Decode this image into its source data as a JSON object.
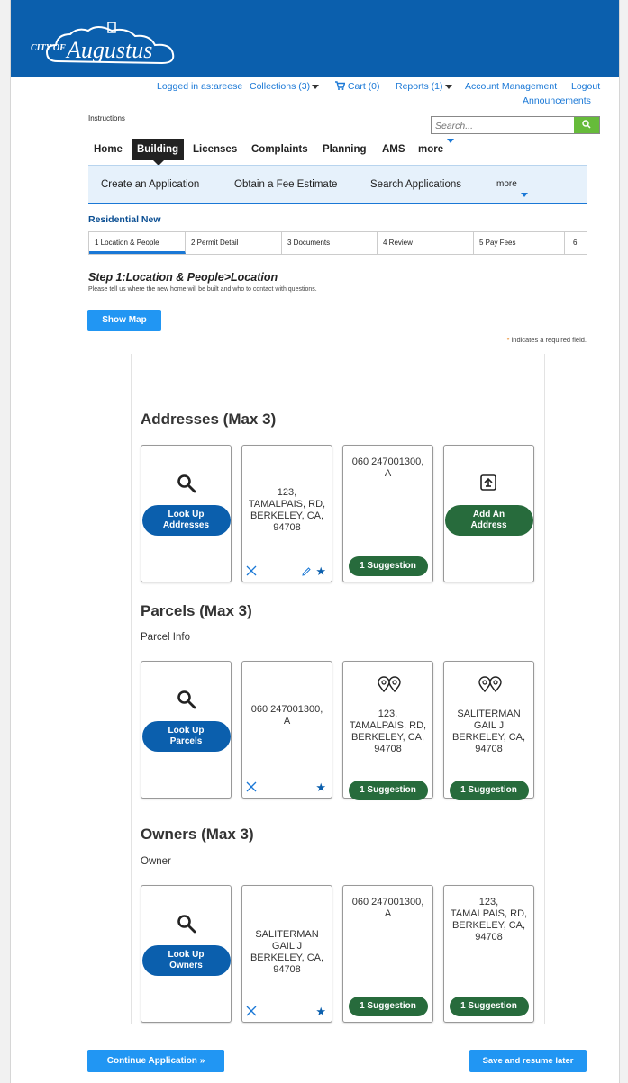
{
  "header": {
    "logo_prefix": "CITY OF",
    "logo_name": "Augustus"
  },
  "toplinks": {
    "logged_in": "Logged in as:areese",
    "collections": "Collections (3)",
    "cart": "Cart (0)",
    "reports": "Reports (1)",
    "account": "Account Management",
    "logout": "Logout",
    "announcements": "Announcements"
  },
  "instructions": "Instructions",
  "search": {
    "placeholder": "Search..."
  },
  "mainnav": [
    "Home",
    "Building",
    "Licenses",
    "Complaints",
    "Planning",
    "AMS",
    "more"
  ],
  "subnav": [
    "Create an Application",
    "Obtain a Fee Estimate",
    "Search Applications",
    "more"
  ],
  "section_label": "Residential New",
  "steps": [
    "1 Location & People",
    "2 Permit Detail",
    "3 Documents",
    "4 Review",
    "5 Pay Fees",
    "6"
  ],
  "step_title": "Step 1:Location & People>Location",
  "step_subtitle": "Please tell us where the new home will be built and who to contact with questions.",
  "show_map": "Show Map",
  "required_note": "indicates a required field.",
  "required_star": "*",
  "addresses": {
    "title": "Addresses (Max 3)",
    "lookup": [
      "Look Up",
      "Addresses"
    ],
    "card2": [
      "123,",
      "TAMALPAIS, RD,",
      "BERKELEY, CA,",
      "94708"
    ],
    "card3": [
      "060 247001300,",
      "A"
    ],
    "suggestion": "1 Suggestion",
    "add": [
      "Add An",
      "Address"
    ]
  },
  "parcels": {
    "title": "Parcels (Max 3)",
    "subtitle": "Parcel Info",
    "lookup": [
      "Look Up",
      "Parcels"
    ],
    "card2": [
      "060 247001300,",
      "A"
    ],
    "card3": [
      "123,",
      "TAMALPAIS, RD,",
      "BERKELEY, CA,",
      "94708"
    ],
    "card4": [
      "SALITERMAN",
      "GAIL J",
      "BERKELEY, CA,",
      "94708"
    ],
    "suggestion": "1 Suggestion"
  },
  "owners": {
    "title": "Owners (Max 3)",
    "subtitle": "Owner",
    "lookup": [
      "Look Up",
      "Owners"
    ],
    "card2": [
      "SALITERMAN",
      "GAIL J",
      "BERKELEY, CA,",
      "94708"
    ],
    "card3": [
      "060 247001300,",
      "A"
    ],
    "card4": [
      "123,",
      "TAMALPAIS, RD,",
      "BERKELEY, CA,",
      "94708"
    ],
    "suggestion": "1 Suggestion"
  },
  "footer": {
    "continue": "Continue Application »",
    "save_later": "Save and resume later"
  },
  "colors": {
    "header_blue": "#0b5fad",
    "link_blue": "#1a78d6",
    "button_blue": "#2196f3",
    "suggestion_green": "#276b3c",
    "search_green": "#66bb3a"
  }
}
